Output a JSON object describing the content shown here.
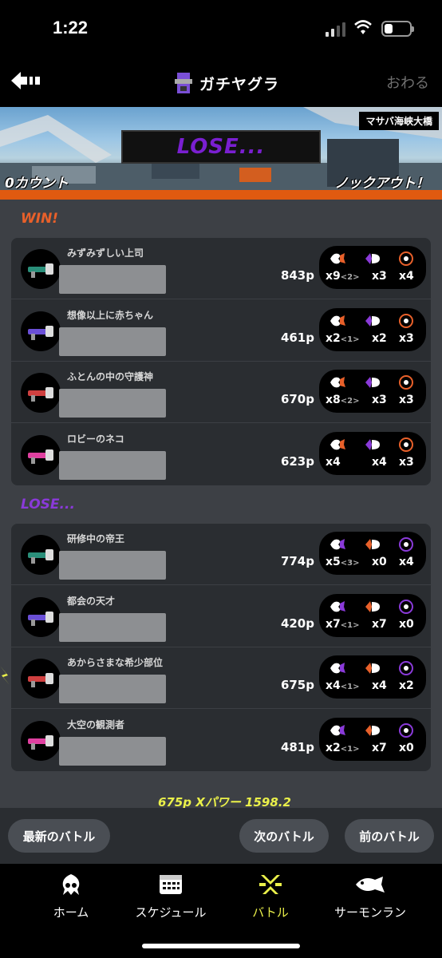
{
  "status_bar": {
    "time": "1:22",
    "battery_level": 0.3
  },
  "nav": {
    "title": "ガチヤグラ",
    "close_label": "おわる"
  },
  "banner": {
    "stage_name": "マサバ海峡大橋",
    "result": "LOSE...",
    "left_count": "0カウント",
    "right_count": "ノックアウト！"
  },
  "teams": {
    "win": {
      "label": "WIN!",
      "players": [
        {
          "name": "みずみずしい上司",
          "points": "843p",
          "kills": "x9",
          "assists": "<2>",
          "specials": "x3",
          "specials_count": "x4"
        },
        {
          "name": "想像以上に赤ちゃん",
          "points": "461p",
          "kills": "x2",
          "assists": "<1>",
          "specials": "x2",
          "specials_count": "x3"
        },
        {
          "name": "ふとんの中の守護神",
          "points": "670p",
          "kills": "x8",
          "assists": "<2>",
          "specials": "x3",
          "specials_count": "x3"
        },
        {
          "name": "ロビーのネコ",
          "points": "623p",
          "kills": "x4",
          "assists": "",
          "specials": "x4",
          "specials_count": "x3"
        }
      ]
    },
    "lose": {
      "label": "LOSE...",
      "players": [
        {
          "name": "研修中の帝王",
          "points": "774p",
          "kills": "x5",
          "assists": "<3>",
          "specials": "x0",
          "specials_count": "x4"
        },
        {
          "name": "都会の天才",
          "points": "420p",
          "kills": "x7",
          "assists": "<1>",
          "specials": "x7",
          "specials_count": "x0"
        },
        {
          "name": "あからさまな希少部位",
          "points": "675p",
          "kills": "x4",
          "assists": "<1>",
          "specials": "x4",
          "specials_count": "x2"
        },
        {
          "name": "大空の観測者",
          "points": "481p",
          "kills": "x2",
          "assists": "<1>",
          "specials": "x7",
          "specials_count": "x0"
        }
      ]
    }
  },
  "summary": "675p Xパワー 1598.2",
  "actions": {
    "latest": "最新のバトル",
    "next": "次のバトル",
    "prev": "前のバトル"
  },
  "tabs": [
    {
      "label": "ホーム",
      "icon": "squid-icon"
    },
    {
      "label": "スケジュール",
      "icon": "calendar-icon"
    },
    {
      "label": "バトル",
      "icon": "battle-icon"
    },
    {
      "label": "サーモンラン",
      "icon": "salmon-icon"
    }
  ],
  "colors": {
    "win": "#e8602a",
    "lose": "#8a3ad9",
    "accent": "#eaf04a"
  }
}
